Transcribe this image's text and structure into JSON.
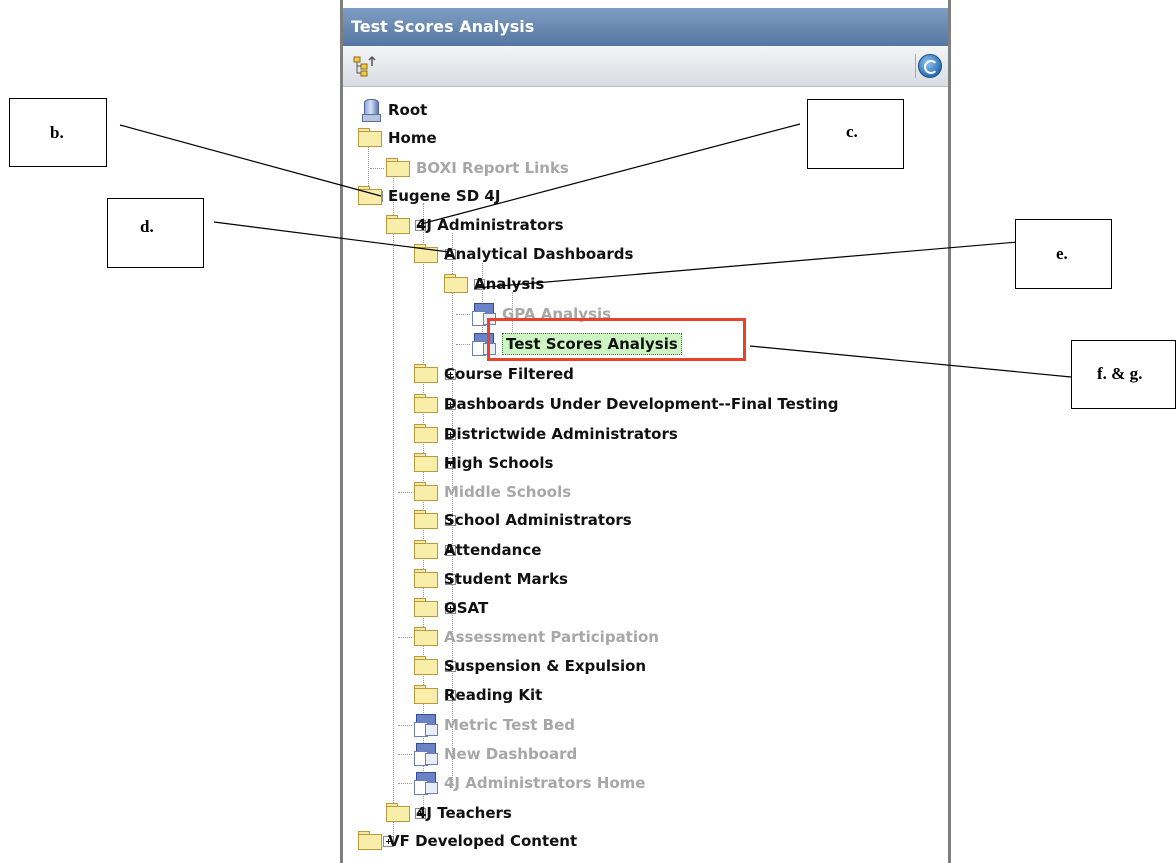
{
  "panel": {
    "title": "Test Scores Analysis"
  },
  "toolbar": {
    "tree_icon": "tree-view-icon",
    "refresh_icon": "refresh-icon"
  },
  "tree": {
    "nodes": [
      {
        "label": "Root",
        "icon": "database-icon",
        "style": "normal"
      },
      {
        "label": "Home",
        "icon": "folder-icon",
        "toggle": "minus",
        "style": "normal"
      },
      {
        "label": "BOXI Report Links",
        "icon": "folder-icon",
        "style": "dim"
      },
      {
        "label": "Eugene SD 4J",
        "icon": "folder-icon",
        "toggle": "minus",
        "style": "normal"
      },
      {
        "label": "4J Administrators",
        "icon": "folder-icon",
        "toggle": "minus",
        "style": "normal"
      },
      {
        "label": "Analytical Dashboards",
        "icon": "folder-icon",
        "toggle": "minus",
        "style": "normal"
      },
      {
        "label": "Analysis",
        "icon": "folder-icon",
        "toggle": "minus",
        "style": "normal"
      },
      {
        "label": "GPA Analysis",
        "icon": "dashboard-icon",
        "style": "dim"
      },
      {
        "label": "Test Scores Analysis",
        "icon": "dashboard-icon",
        "style": "selected"
      },
      {
        "label": "Course Filtered",
        "icon": "folder-icon",
        "toggle": "plus",
        "style": "normal"
      },
      {
        "label": "Dashboards Under Development--Final Testing",
        "icon": "folder-icon",
        "toggle": "plus",
        "style": "normal"
      },
      {
        "label": "Districtwide Administrators",
        "icon": "folder-icon",
        "toggle": "plus",
        "style": "normal"
      },
      {
        "label": "High Schools",
        "icon": "folder-icon",
        "toggle": "plus",
        "style": "normal"
      },
      {
        "label": "Middle Schools",
        "icon": "folder-icon",
        "style": "dim"
      },
      {
        "label": "School Administrators",
        "icon": "folder-icon",
        "toggle": "plus",
        "style": "normal"
      },
      {
        "label": "Attendance",
        "icon": "folder-icon",
        "toggle": "plus",
        "style": "normal"
      },
      {
        "label": "Student Marks",
        "icon": "folder-icon",
        "toggle": "plus",
        "style": "normal"
      },
      {
        "label": "OSAT",
        "icon": "folder-icon",
        "toggle": "plus",
        "style": "normal"
      },
      {
        "label": "Assessment Participation",
        "icon": "folder-icon",
        "style": "dim"
      },
      {
        "label": "Suspension & Expulsion",
        "icon": "folder-icon",
        "toggle": "plus",
        "style": "normal"
      },
      {
        "label": "Reading Kit",
        "icon": "folder-icon",
        "toggle": "plus",
        "style": "normal"
      },
      {
        "label": "Metric Test Bed",
        "icon": "dashboard-icon",
        "style": "dim"
      },
      {
        "label": "New Dashboard",
        "icon": "dashboard-icon",
        "style": "dim"
      },
      {
        "label": "4J Administrators Home",
        "icon": "dashboard-icon",
        "style": "dim"
      },
      {
        "label": "4J Teachers",
        "icon": "folder-icon",
        "toggle": "plus",
        "style": "normal"
      },
      {
        "label": "VF Developed Content",
        "icon": "folder-icon",
        "toggle": "plus",
        "style": "normal"
      }
    ]
  },
  "callouts": {
    "b": "b.",
    "c": "c.",
    "d": "d.",
    "e": "e.",
    "fg": "f. & g."
  },
  "colors": {
    "highlight_border": "#e8412c",
    "selected_bg": "#cdf5c3",
    "title_bar": "#5576a3"
  }
}
